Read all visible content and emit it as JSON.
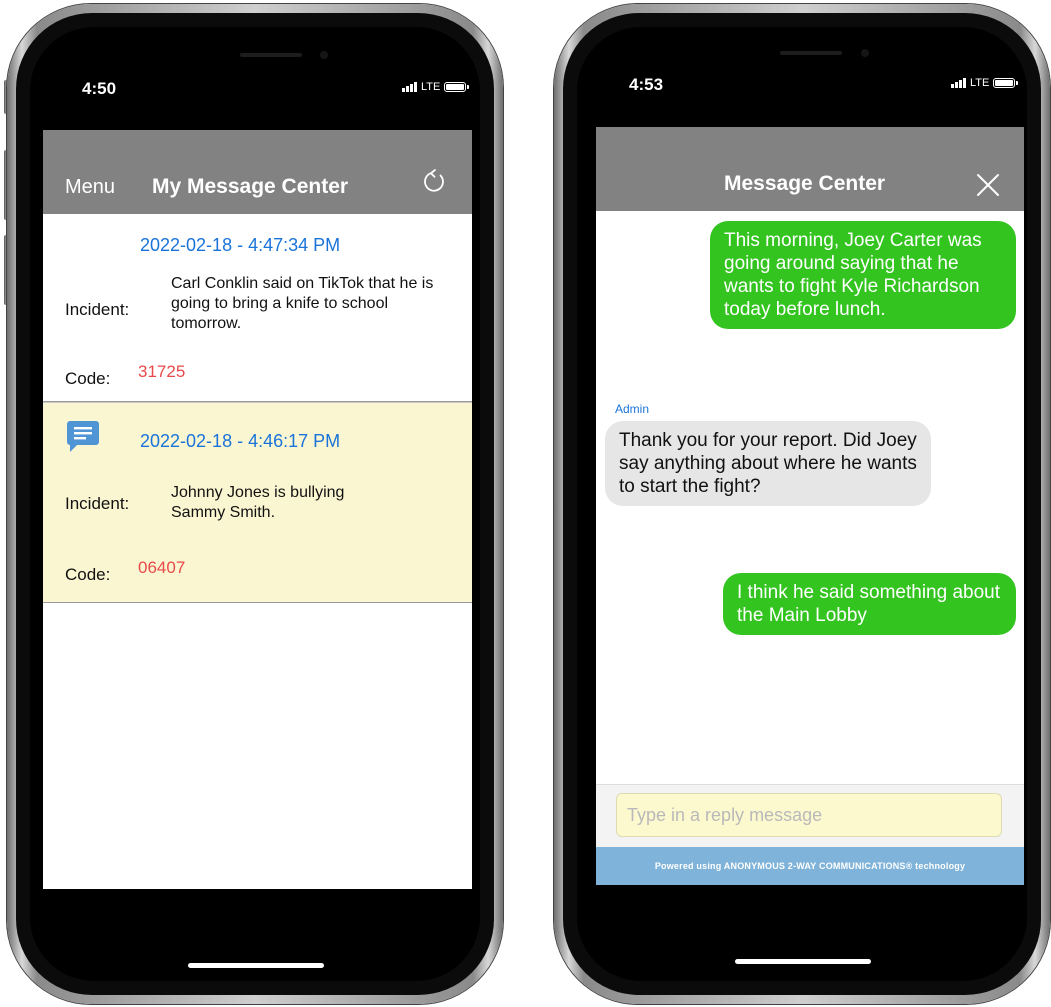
{
  "left_phone": {
    "status_time": "4:50",
    "network": "LTE",
    "header": {
      "menu_label": "Menu",
      "title": "My Message Center",
      "refresh_icon": "refresh-icon"
    },
    "messages": [
      {
        "date": "2022-02-18 - 4:47:34 PM",
        "incident_label": "Incident:",
        "incident_text": "Carl Conklin said on TikTok that he is going to bring a knife to school tomorrow.",
        "code_label": "Code:",
        "code": "31725",
        "has_reply_icon": false,
        "background": "#ffffff"
      },
      {
        "date": "2022-02-18 - 4:46:17 PM",
        "incident_label": "Incident:",
        "incident_text": "Johnny Jones is bullying Sammy Smith.",
        "code_label": "Code:",
        "code": "06407",
        "has_reply_icon": true,
        "background": "#fbf6d2"
      }
    ]
  },
  "right_phone": {
    "status_time": "4:53",
    "network": "LTE",
    "header": {
      "title": "Message Center",
      "close_icon": "close-icon"
    },
    "conversation": [
      {
        "direction": "out",
        "text": "This morning, Joey Carter was going around saying that he wants to fight Kyle Richardson today before lunch."
      },
      {
        "direction": "in",
        "sender": "Admin",
        "text": "Thank you for your report. Did Joey say anything about where he wants to start the fight?"
      },
      {
        "direction": "out",
        "text": "I think he said something about the Main Lobby"
      }
    ],
    "reply": {
      "placeholder": "Type in a reply message",
      "value": ""
    },
    "powered_by": "Powered using ANONYMOUS 2-WAY COMMUNICATIONS® technology"
  },
  "colors": {
    "header_bg": "#828282",
    "date_blue": "#1a73d9",
    "code_red": "#e84a4a",
    "highlight_row": "#fbf6d2",
    "outgoing_bubble": "#33c41f",
    "incoming_bubble": "#e6e6e6",
    "input_bg": "#fdf9cf",
    "footer_bar": "#7fb3d9"
  }
}
